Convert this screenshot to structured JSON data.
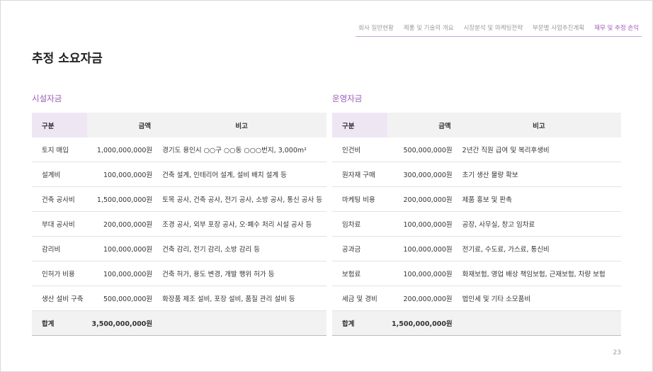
{
  "nav": {
    "items": [
      "회사 일반현황",
      "제품 및 기술의 개요",
      "시장분석 및 마케팅전략",
      "부문별 사업추진계획",
      "재무 및 추정 손익"
    ]
  },
  "page_title": "추정 소요자금",
  "facility": {
    "title": "시설자금",
    "headers": {
      "category": "구분",
      "amount": "금액",
      "note": "비고"
    },
    "rows": [
      {
        "category": "토지 매입",
        "amount": "1,000,000,000원",
        "note": "경기도 용인시 ○○구 ○○동 ○○○번지, 3,000m²"
      },
      {
        "category": "설계비",
        "amount": "100,000,000원",
        "note": "건축 설계, 인테리어 설계, 설비 배치 설계 등"
      },
      {
        "category": "건축 공사비",
        "amount": "1,500,000,000원",
        "note": "토목 공사, 건축 공사, 전기 공사, 소방 공사, 통신 공사 등"
      },
      {
        "category": "부대 공사비",
        "amount": "200,000,000원",
        "note": "조경 공사, 외부 포장 공사, 오·폐수 처리 시설 공사 등"
      },
      {
        "category": "감리비",
        "amount": "100,000,000원",
        "note": "건축 감리, 전기 감리, 소방 감리 등"
      },
      {
        "category": "인허가 비용",
        "amount": "100,000,000원",
        "note": "건축 허가, 용도 변경, 개발 행위 허가 등"
      },
      {
        "category": "생산 설비 구축",
        "amount": "500,000,000원",
        "note": "화장품 제조 설비, 포장 설비, 품질 관리 설비 등"
      }
    ],
    "total": {
      "label": "합계",
      "amount": "3,500,000,000원"
    }
  },
  "operating": {
    "title": "운영자금",
    "headers": {
      "category": "구분",
      "amount": "금액",
      "note": "비고"
    },
    "rows": [
      {
        "category": "인건비",
        "amount": "500,000,000원",
        "note": "2년간 직원 급여 및 복리후생비"
      },
      {
        "category": "원자재 구매",
        "amount": "300,000,000원",
        "note": "초기 생산 물량 확보"
      },
      {
        "category": "마케팅 비용",
        "amount": "200,000,000원",
        "note": "제품 홍보 및 판촉"
      },
      {
        "category": "임차료",
        "amount": "100,000,000원",
        "note": "공장, 사무실, 창고 임차료"
      },
      {
        "category": "공과금",
        "amount": "100,000,000원",
        "note": "전기료, 수도료, 가스료, 통신비"
      },
      {
        "category": "보험료",
        "amount": "100,000,000원",
        "note": "화재보험, 영업 배상 책임보험, 근재보험, 차량 보험"
      },
      {
        "category": "세금 및 경비",
        "amount": "200,000,000원",
        "note": "법인세 및 기타 소모품비"
      }
    ],
    "total": {
      "label": "합계",
      "amount": "1,500,000,000원"
    }
  },
  "page_number": "23",
  "colors": {
    "accent": "#9b59b6",
    "header_bg": "#f2f2f2",
    "header_cat_bg": "#efe6f4"
  }
}
